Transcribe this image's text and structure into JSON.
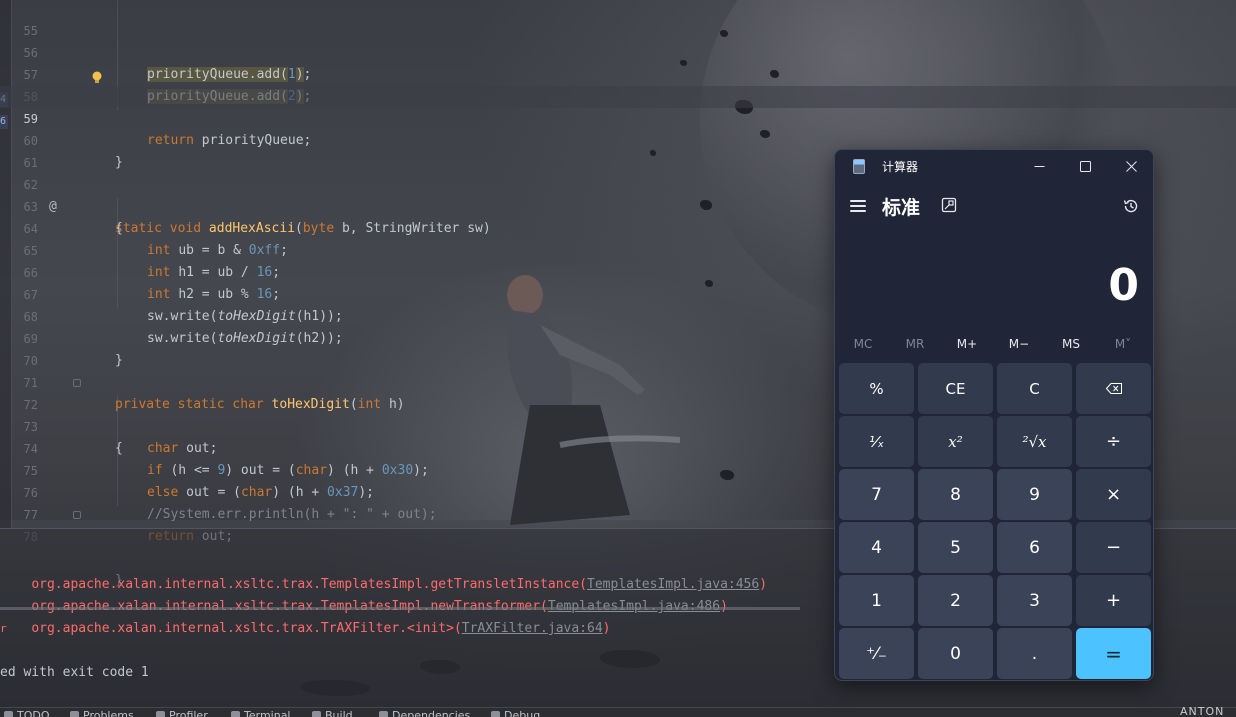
{
  "editor": {
    "lines": [
      {
        "num": "55",
        "code": ""
      },
      {
        "num": "56",
        "code": "priorityQueue.add(1);"
      },
      {
        "num": "57",
        "code": "priorityQueue.add(2);"
      },
      {
        "num": "58",
        "code": "return priorityQueue;"
      },
      {
        "num": "59",
        "code": ""
      },
      {
        "num": "60",
        "code": "}"
      },
      {
        "num": "61",
        "code": ""
      },
      {
        "num": "62",
        "code": "static void addHexAscii(byte b, StringWriter sw)"
      },
      {
        "num": "63",
        "code": "{"
      },
      {
        "num": "64",
        "code": "int ub = b & 0xff;"
      },
      {
        "num": "65",
        "code": "int h1 = ub / 16;"
      },
      {
        "num": "66",
        "code": "int h2 = ub % 16;"
      },
      {
        "num": "67",
        "code": "sw.write(toHexDigit(h1));"
      },
      {
        "num": "68",
        "code": "sw.write(toHexDigit(h2));"
      },
      {
        "num": "69",
        "code": "}"
      },
      {
        "num": "70",
        "code": ""
      },
      {
        "num": "71",
        "code": "private static char toHexDigit(int h)"
      },
      {
        "num": "72",
        "code": "{"
      },
      {
        "num": "73",
        "code": "char out;"
      },
      {
        "num": "74",
        "code": "if (h <= 9) out = (char) (h + 0x30);"
      },
      {
        "num": "75",
        "code": "else out = (char) (h + 0x37);"
      },
      {
        "num": "76",
        "code": "//System.err.println(h + \": \" + out);"
      },
      {
        "num": "77",
        "code": "return out;"
      },
      {
        "num": "78",
        "code": "}"
      }
    ],
    "edge_markers": [
      "4",
      "6"
    ],
    "annotation_glyph": "@"
  },
  "console": {
    "lines": [
      {
        "prefix": "org.apache.xalan.internal.xsltc.trax.TemplatesImpl.getTransletInstance(",
        "link": "TemplatesImpl.java:456",
        "suffix": ")"
      },
      {
        "prefix": "org.apache.xalan.internal.xsltc.trax.TemplatesImpl.newTransformer(",
        "link": "TemplatesImpl.java:486",
        "suffix": ")"
      },
      {
        "prefix": "org.apache.xalan.internal.xsltc.trax.TrAXFilter.<init>(",
        "link": "TrAXFilter.java:64",
        "suffix": ")"
      }
    ],
    "stray": "r",
    "exit_message": "ed with exit code 1"
  },
  "toolbar": {
    "items": [
      "TODO",
      "Problems",
      "Profiler",
      "Terminal",
      "Build",
      "Dependencies",
      "Debug"
    ]
  },
  "watermark": "ANTON",
  "calculator": {
    "window_title": "计算器",
    "mode": "标准",
    "display": "0",
    "memory": [
      {
        "label": "MC",
        "enabled": false
      },
      {
        "label": "MR",
        "enabled": false
      },
      {
        "label": "M+",
        "enabled": true
      },
      {
        "label": "M−",
        "enabled": true
      },
      {
        "label": "MS",
        "enabled": true
      },
      {
        "label": "M˅",
        "enabled": false
      }
    ],
    "keys": [
      [
        "%",
        "CE",
        "C",
        "⌫"
      ],
      [
        "¹⁄ₓ",
        "x²",
        "²√x",
        "÷"
      ],
      [
        "7",
        "8",
        "9",
        "×"
      ],
      [
        "4",
        "5",
        "6",
        "−"
      ],
      [
        "1",
        "2",
        "3",
        "+"
      ],
      [
        "⁺⁄₋",
        "0",
        ".",
        "="
      ]
    ],
    "colors": {
      "background": "#202637",
      "key": "#323a4d",
      "digit_key": "#3b4358",
      "equals": "#4cc2ff"
    }
  }
}
